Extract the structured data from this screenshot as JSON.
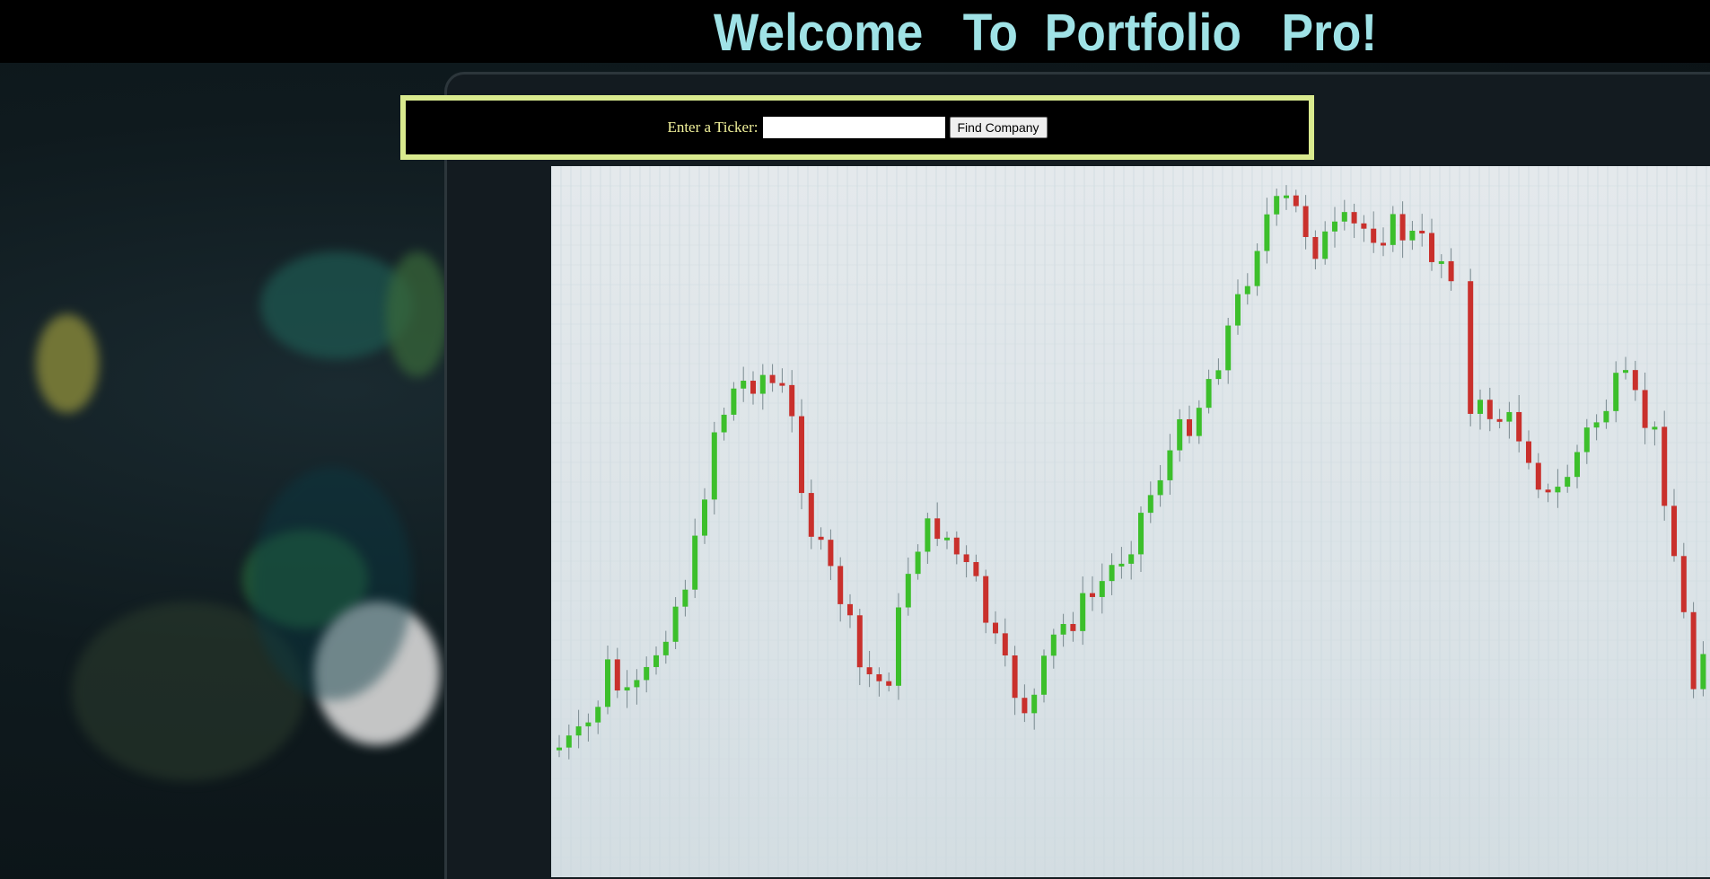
{
  "header": {
    "title": "Welcome   To  Portfolio   Pro!"
  },
  "search": {
    "label": "Enter a Ticker:",
    "input_value": "",
    "button_label": "Find Company"
  },
  "colors": {
    "title": "#9fe2e6",
    "panel_border": "#d9ea8e",
    "label": "#f1f19a",
    "bull": "#3cbf2b",
    "bear": "#c9302c"
  }
}
